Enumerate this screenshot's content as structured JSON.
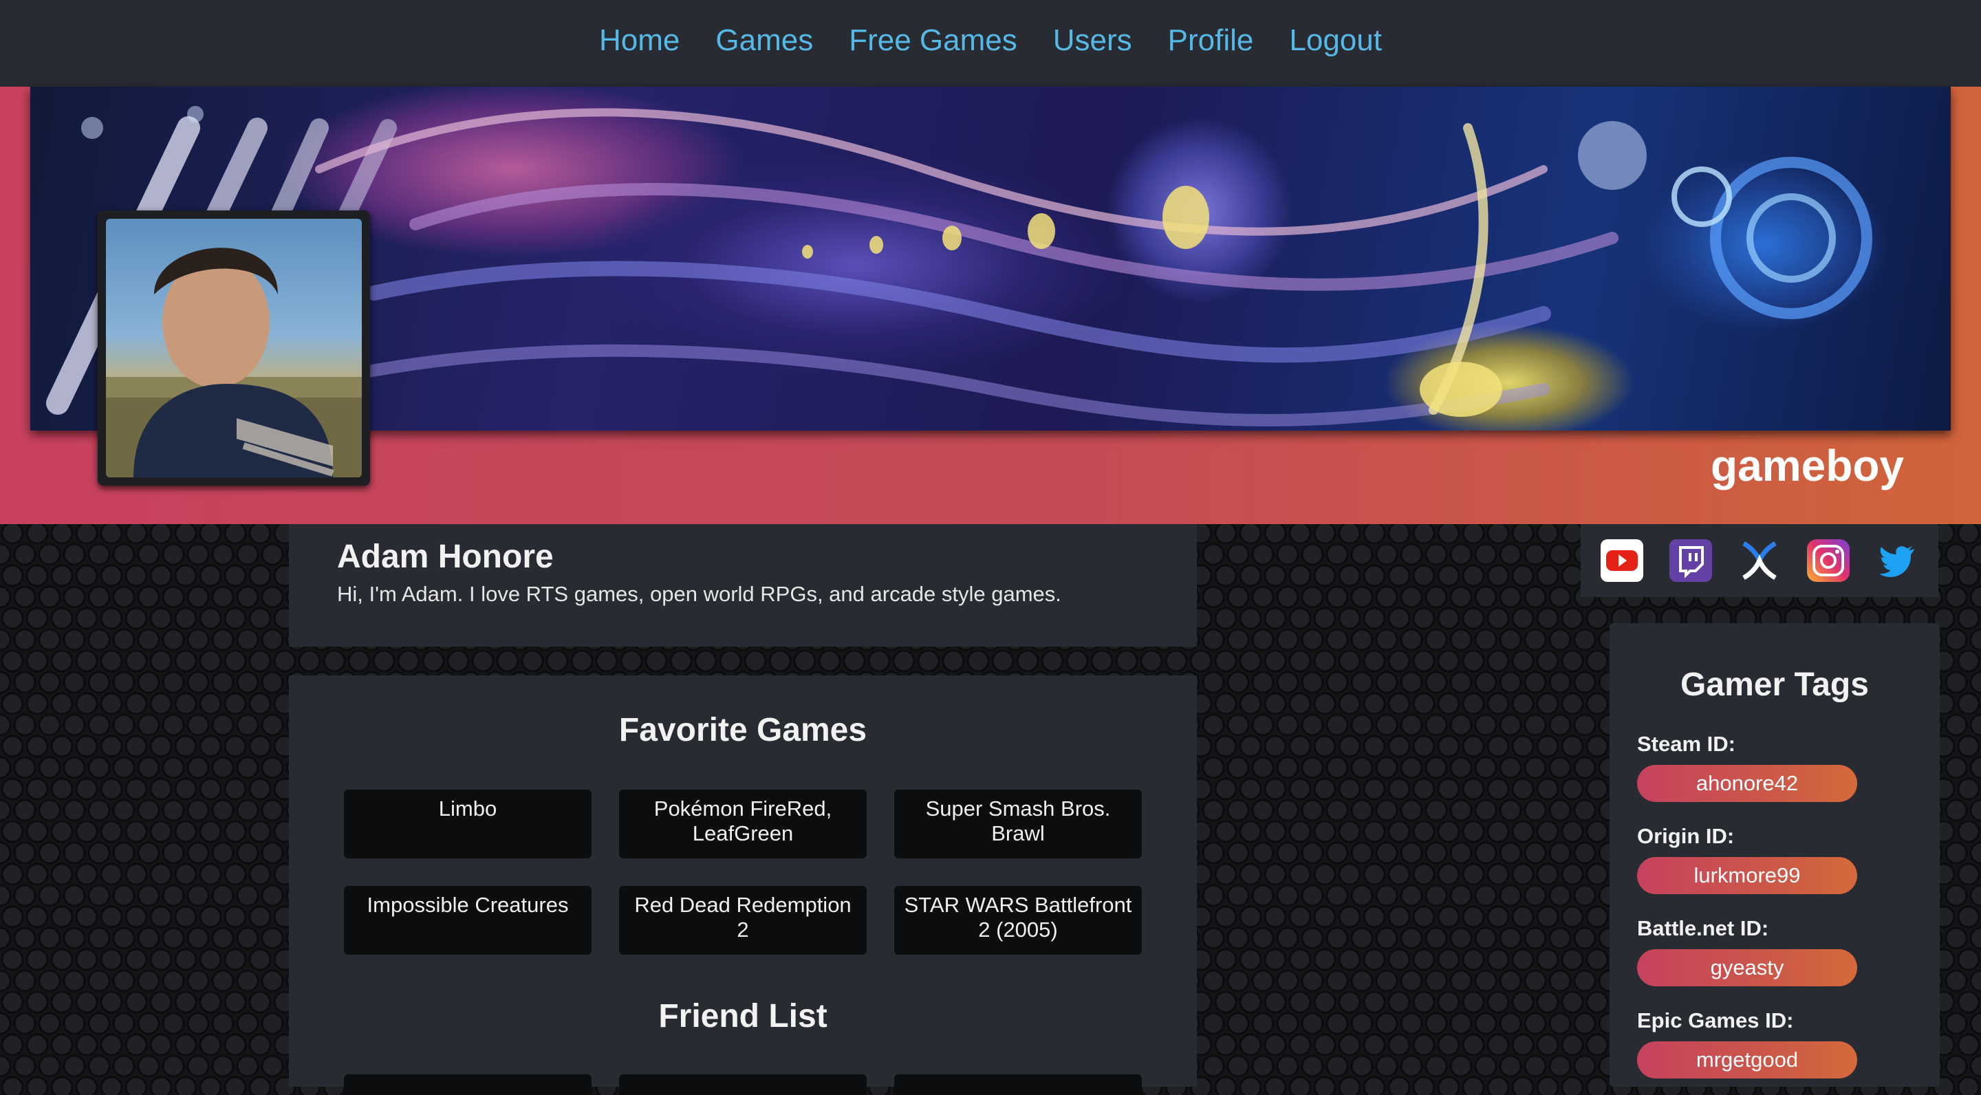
{
  "nav": {
    "items": [
      "Home",
      "Games",
      "Free Games",
      "Users",
      "Profile",
      "Logout"
    ]
  },
  "profile": {
    "username": "gameboy",
    "full_name": "Adam Honore",
    "bio": "Hi, I'm Adam. I love RTS games, open world RPGs, and arcade style games."
  },
  "favorites": {
    "title": "Favorite Games",
    "games": [
      "Limbo",
      "Pokémon FireRed, LeafGreen",
      "Super Smash Bros. Brawl",
      "Impossible Creatures",
      "Red Dead Redemption 2",
      "STAR WARS Battlefront 2 (2005)"
    ]
  },
  "friends": {
    "title": "Friend List"
  },
  "social": {
    "icons": [
      "youtube-icon",
      "twitch-icon",
      "xbox-icon",
      "instagram-icon",
      "twitter-icon"
    ]
  },
  "gamer_tags": {
    "title": "Gamer Tags",
    "tags": [
      {
        "label": "Steam ID:",
        "value": "ahonore42"
      },
      {
        "label": "Origin ID:",
        "value": "lurkmore99"
      },
      {
        "label": "Battle.net ID:",
        "value": "gyeasty"
      },
      {
        "label": "Epic Games ID:",
        "value": "mrgetgood"
      }
    ]
  },
  "colors": {
    "nav_link": "#56b8e6",
    "panel": "#282b31",
    "accent_start": "#c8415e",
    "accent_end": "#d1643a"
  }
}
